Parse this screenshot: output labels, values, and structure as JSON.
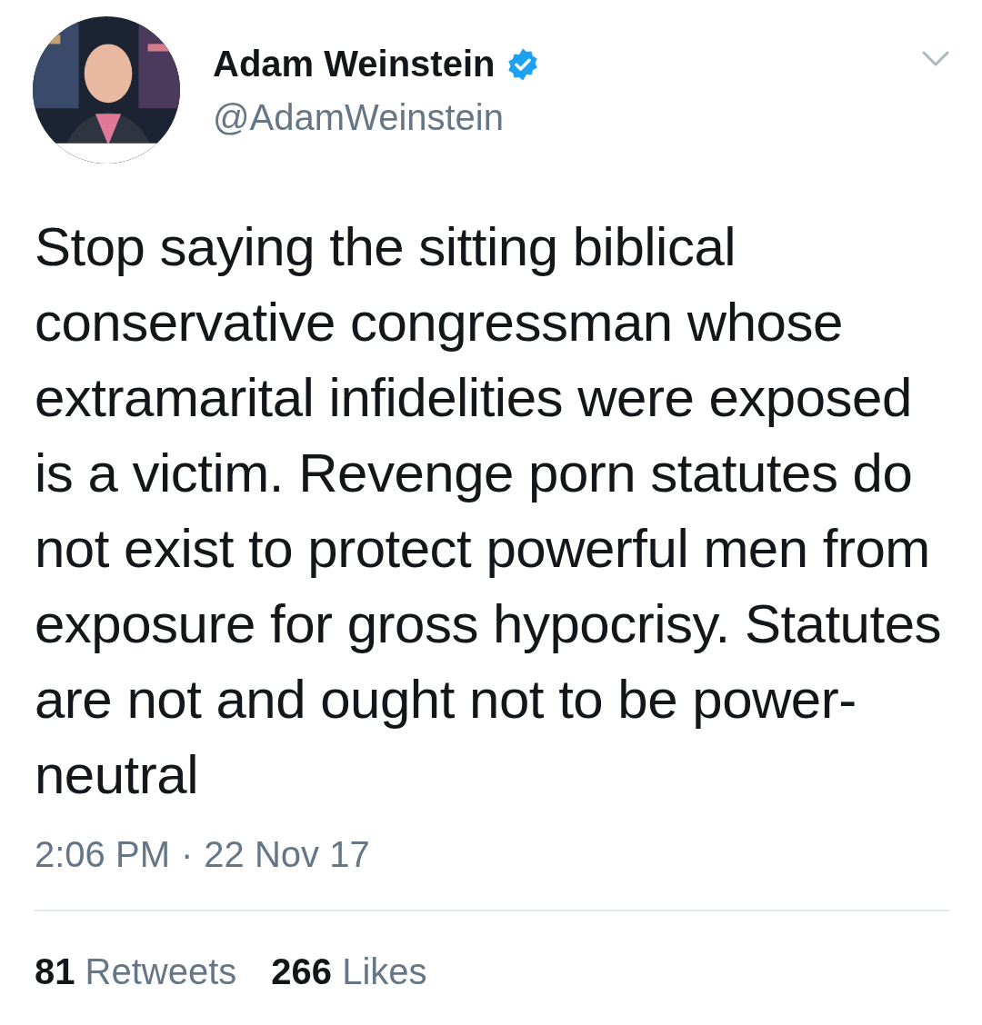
{
  "author": {
    "name": "Adam Weinstein",
    "verified": true,
    "handle": "@AdamWeinstein"
  },
  "tweet": {
    "text": "Stop saying the sitting biblical conservative congressman whose extramarital infidelities were exposed is a victim. Revenge porn statutes do not exist to protect powerful men from exposure for gross hypocrisy. Statutes are not and ought not to be power-neutral",
    "time": "2:06 PM",
    "separator": "·",
    "date": "22 Nov 17"
  },
  "stats": [
    {
      "count": "81",
      "label": "Retweets"
    },
    {
      "count": "266",
      "label": "Likes"
    }
  ]
}
